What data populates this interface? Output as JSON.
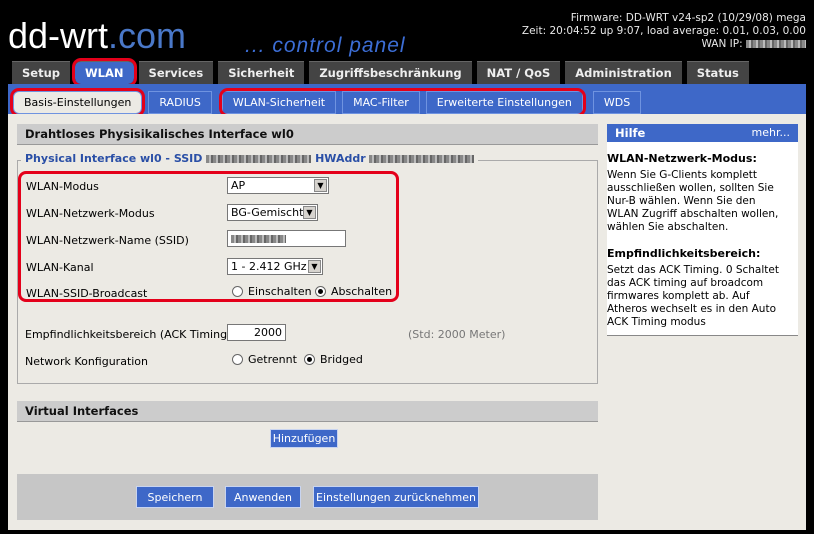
{
  "header": {
    "logo": "dd-wrt",
    "logo_dot": ".com",
    "subtitle": "... control panel",
    "firmware": "Firmware: DD-WRT v24-sp2 (10/29/08) mega",
    "time": "Zeit: 20:04:52 up 9:07, load average: 0.01, 0.03, 0.00",
    "wan_ip_label": "WAN IP:"
  },
  "main_tabs": [
    {
      "label": "Setup"
    },
    {
      "label": "WLAN"
    },
    {
      "label": "Services"
    },
    {
      "label": "Sicherheit"
    },
    {
      "label": "Zugriffsbeschränkung"
    },
    {
      "label": "NAT / QoS"
    },
    {
      "label": "Administration"
    },
    {
      "label": "Status"
    }
  ],
  "sub_tabs": [
    {
      "label": "Basis-Einstellungen"
    },
    {
      "label": "RADIUS"
    },
    {
      "label": "WLAN-Sicherheit"
    },
    {
      "label": "MAC-Filter"
    },
    {
      "label": "Erweiterte Einstellungen"
    },
    {
      "label": "WDS"
    }
  ],
  "section1": {
    "title": "Drahtloses Physisikalisches Interface wl0",
    "legend_prefix": "Physical Interface wl0 - SSID",
    "legend_hw": "HWAddr",
    "fields": {
      "mode_label": "WLAN-Modus",
      "mode_value": "AP",
      "netmode_label": "WLAN-Netzwerk-Modus",
      "netmode_value": "BG-Gemischt",
      "ssid_label": "WLAN-Netzwerk-Name (SSID)",
      "channel_label": "WLAN-Kanal",
      "channel_value": "1 - 2.412 GHz",
      "broadcast_label": "WLAN-SSID-Broadcast",
      "broadcast_on": "Einschalten",
      "broadcast_off": "Abschalten",
      "ack_label": "Empfindlichkeitsbereich (ACK Timing)",
      "ack_value": "2000",
      "ack_default": "(Std: 2000 Meter)",
      "netconf_label": "Network Konfiguration",
      "netconf_separate": "Getrennt",
      "netconf_bridged": "Bridged"
    }
  },
  "section2": {
    "title": "Virtual Interfaces",
    "add_button": "Hinzufügen"
  },
  "buttons": {
    "save": "Speichern",
    "apply": "Anwenden",
    "reset": "Einstellungen zurücknehmen"
  },
  "help": {
    "title": "Hilfe",
    "more": "mehr...",
    "h1": "WLAN-Netzwerk-Modus:",
    "p1": "Wenn Sie G-Clients komplett ausschließen wollen, sollten Sie Nur-B wählen. Wenn Sie den WLAN Zugriff abschalten wollen, wählen Sie abschalten.",
    "h2": "Empfindlichkeitsbereich:",
    "p2": "Setzt das ACK Timing. 0 Schaltet das ACK timing auf broadcom firmwares komplett ab. Auf Atheros wechselt es in den Auto ACK Timing modus"
  },
  "colors": {
    "accent": "#3e68c8",
    "highlight": "#e4001a"
  }
}
